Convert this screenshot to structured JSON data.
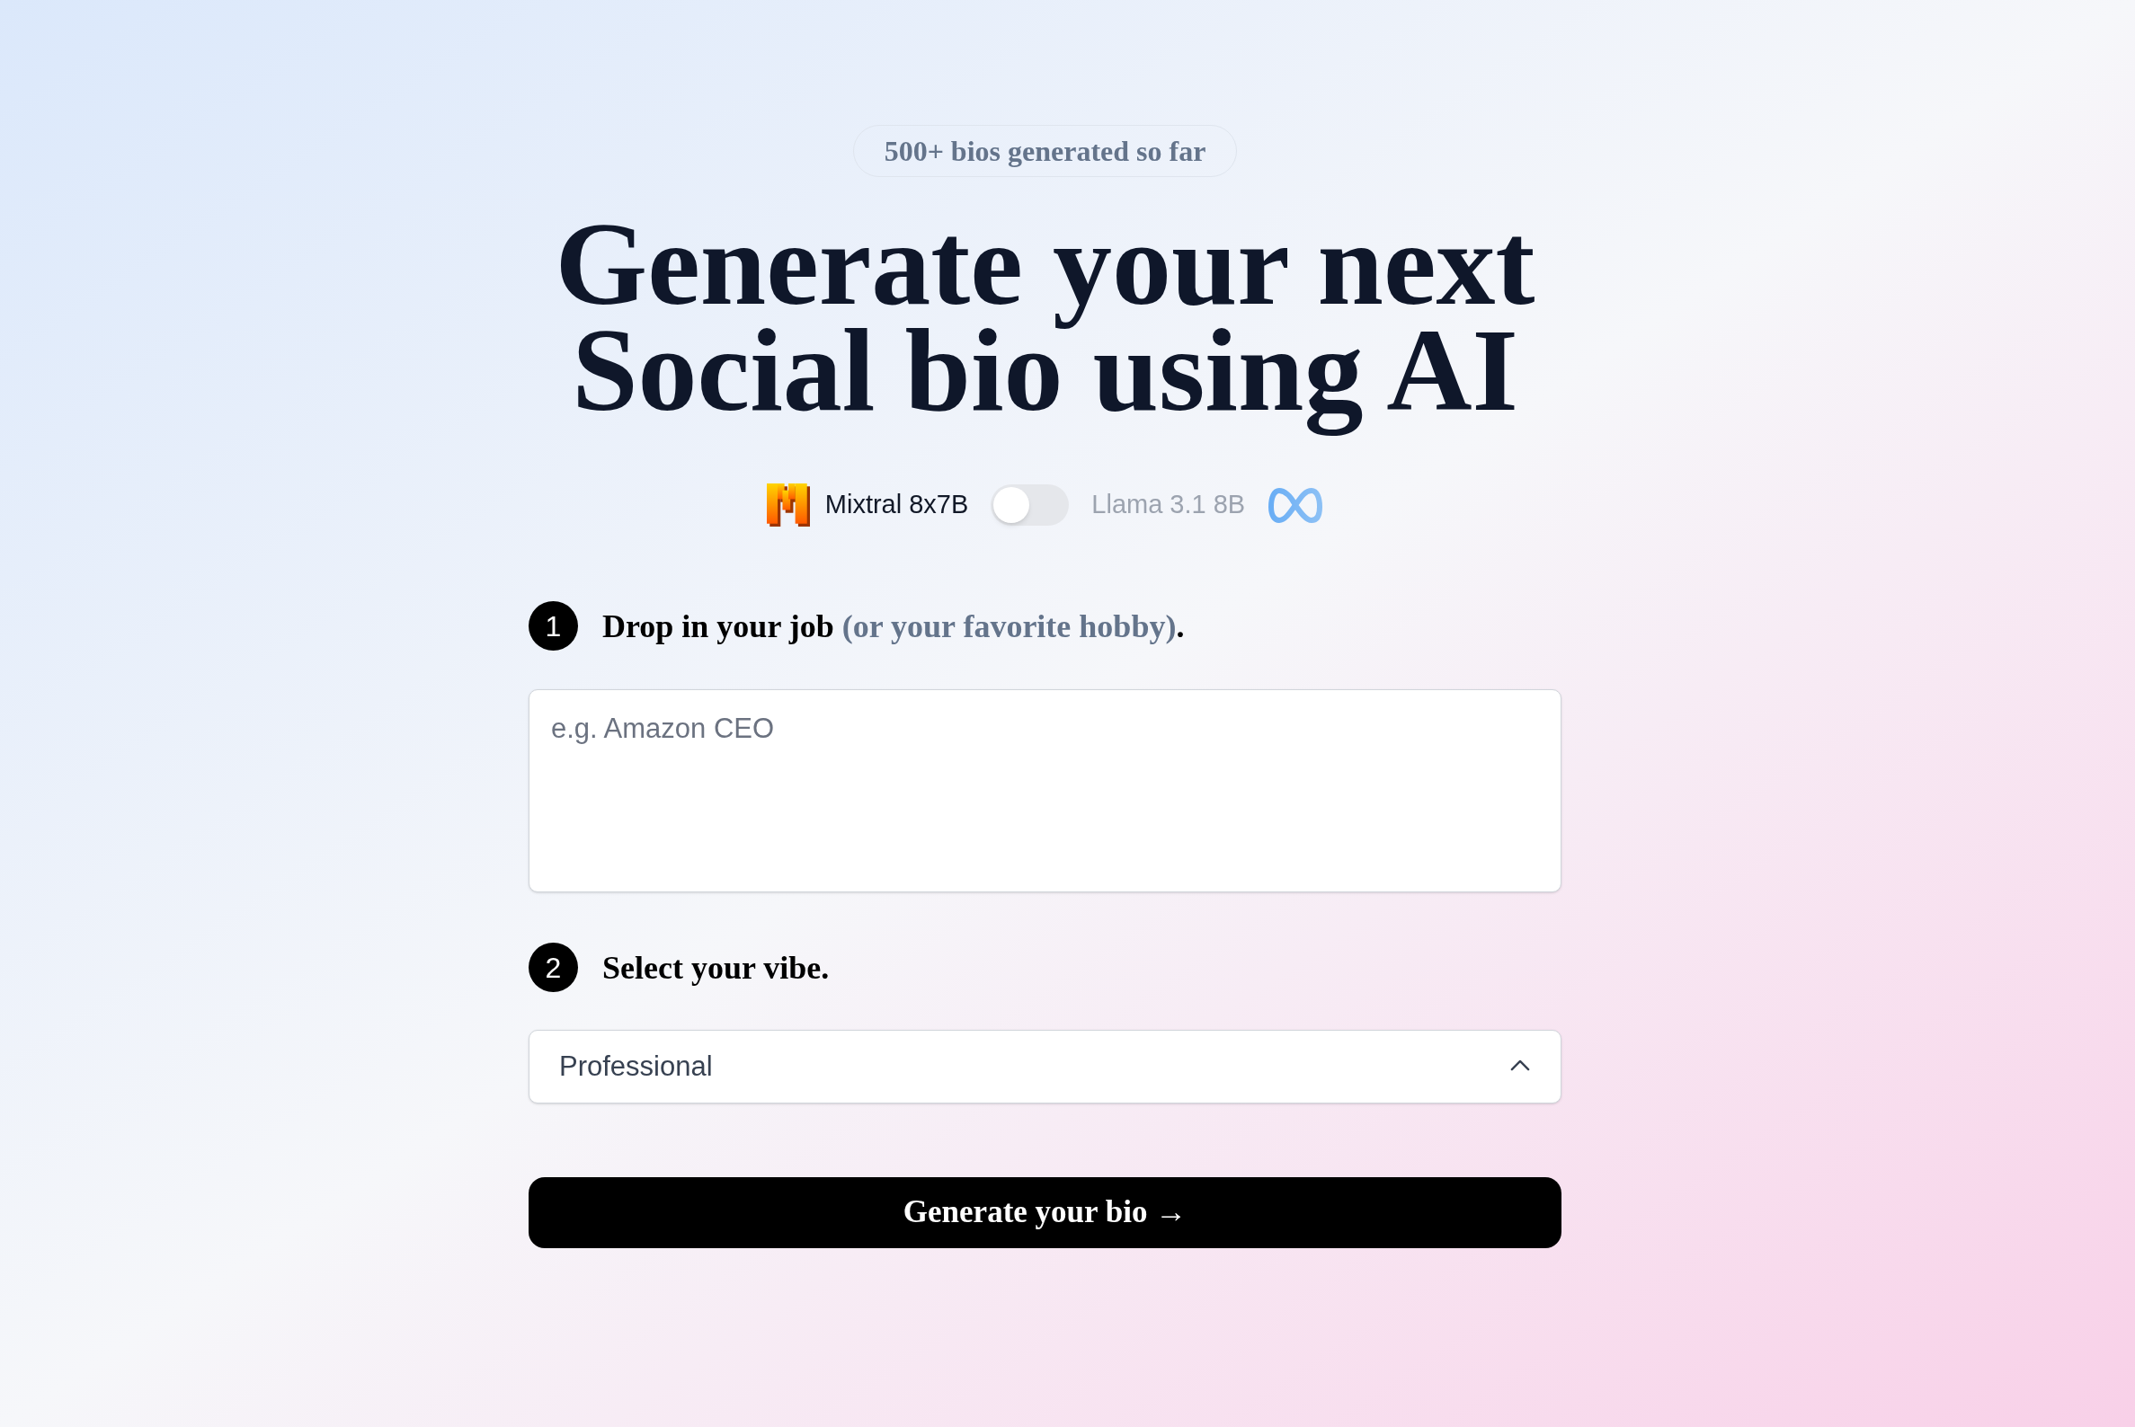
{
  "badge": {
    "text": "500+ bios generated so far"
  },
  "heading": {
    "lines": [
      "Generate your next",
      "Social bio using AI"
    ]
  },
  "model_switch": {
    "left_label": "Mixtral 8x7B",
    "right_label": "Llama 3.1 8B",
    "on": false
  },
  "steps": [
    {
      "number": "1",
      "label": [
        {
          "text": "Drop in your job ",
          "muted": false
        },
        {
          "text": "(or your favorite hobby)",
          "muted": true
        },
        {
          "text": ".",
          "muted": false
        }
      ],
      "field": {
        "kind": "textarea",
        "placeholder": "e.g. Amazon CEO"
      }
    },
    {
      "number": "2",
      "label": [
        {
          "text": "Select your vibe.",
          "muted": false
        }
      ],
      "field": {
        "kind": "select",
        "value": "Professional"
      }
    }
  ],
  "submit_button": {
    "label": "Generate your bio →"
  }
}
